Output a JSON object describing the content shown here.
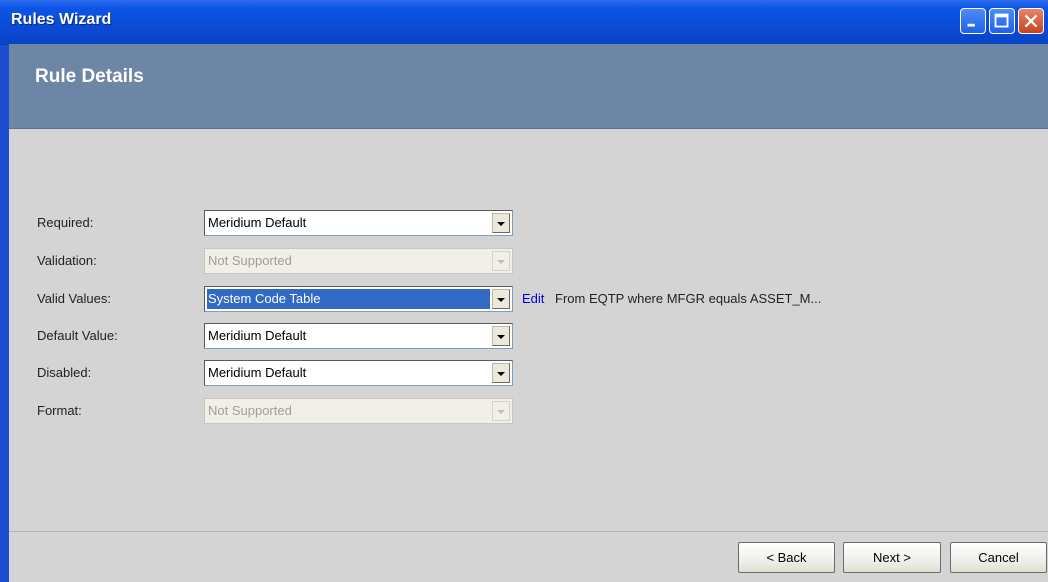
{
  "window": {
    "title": "Rules Wizard"
  },
  "header": {
    "title": "Rule Details"
  },
  "colors": {
    "titlebar": "#0a4cd8",
    "header": "#6e86a6",
    "selection": "#316ac5",
    "link": "#0000d0"
  },
  "fields": {
    "required": {
      "label": "Required:",
      "value": "Meridium Default"
    },
    "validation": {
      "label": "Validation:",
      "value": "Not Supported"
    },
    "valid_values": {
      "label": "Valid Values:",
      "value": "System Code Table",
      "edit": "Edit",
      "description": "From EQTP where MFGR equals ASSET_M..."
    },
    "default_value": {
      "label": "Default Value:",
      "value": "Meridium Default"
    },
    "disabled": {
      "label": "Disabled:",
      "value": "Meridium Default"
    },
    "format": {
      "label": "Format:",
      "value": "Not Supported"
    }
  },
  "buttons": {
    "back": "< Back",
    "next": "Next >",
    "cancel": "Cancel"
  },
  "icons": {
    "minimize": "minimize-icon",
    "maximize": "maximize-icon",
    "close": "close-icon"
  }
}
